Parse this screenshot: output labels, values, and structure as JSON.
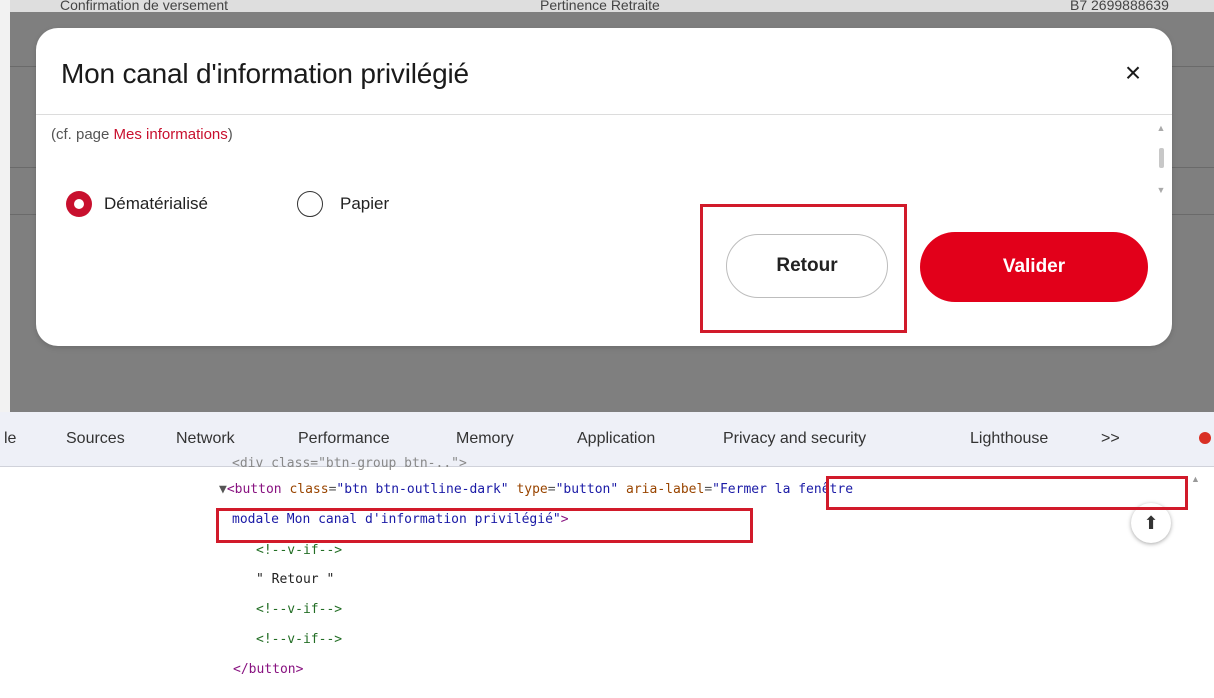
{
  "background_page": {
    "row_col1": "Confirmation de versement",
    "row_col2": "Pertinence Retraite",
    "row_col3": "B7 2699888639"
  },
  "modal": {
    "title": "Mon canal d'information privilégié",
    "close_icon_glyph": "×",
    "note_prefix": "(cf. page ",
    "note_link": "Mes informations",
    "note_suffix": ")",
    "options": [
      {
        "label": "Dématérialisé",
        "checked": true
      },
      {
        "label": "Papier",
        "checked": false
      }
    ],
    "retour_label": "Retour",
    "valider_label": "Valider",
    "accent_color": "#e2001a"
  },
  "devtools": {
    "tabs": [
      "le",
      "Sources",
      "Network",
      "Performance",
      "Memory",
      "Application",
      "Privacy and security",
      "Lighthouse",
      ">>"
    ],
    "code": {
      "l0": "<div class=\"btn-group btn-..\">",
      "l1_tag_open": "<button",
      "l1_attr_class": "class",
      "l1_val_class": "\"btn btn-outline-dark\"",
      "l1_attr_type": "type",
      "l1_val_type": "\"button\"",
      "l1_attr_aria": "aria-label",
      "l1_val_aria_start": "\"Fermer la fenêtre",
      "l2_val_aria_end": "modale Mon canal d'information privilégié\"",
      "l2_tag_close": ">",
      "l3": "<!--v-if-->",
      "l4": "\" Retour \"",
      "l5": "<!--v-if-->",
      "l6": "<!--v-if-->",
      "l7": "</button>"
    },
    "pin_icon_glyph": "⬆"
  }
}
